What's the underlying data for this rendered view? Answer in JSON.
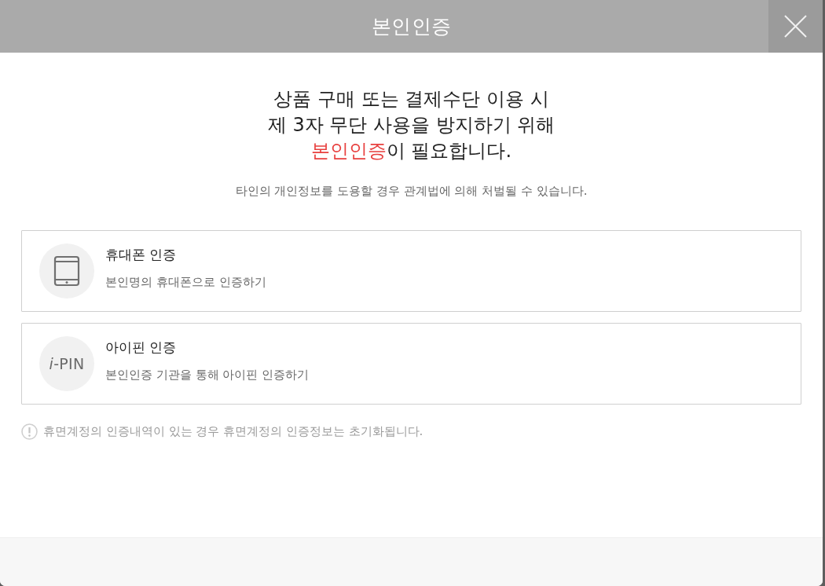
{
  "window": {
    "title": "본인인증"
  },
  "message": {
    "lines": [
      [
        {
          "text": "상품 구매 또는 결제수단 이용 시",
          "highlight": false
        }
      ],
      [
        {
          "text": "제 3자 무단 사용을 방지하기 위해",
          "highlight": false
        }
      ],
      [
        {
          "text": "본인인증",
          "highlight": true
        },
        {
          "text": "이 필요합니다.",
          "highlight": false
        }
      ]
    ],
    "warning": "타인의 개인정보를 도용할 경우 관계법에 의해 처벌될 수 있습니다."
  },
  "options": [
    {
      "kind": "phone",
      "title": "휴대폰 인증",
      "description": "본인명의 휴대폰으로 인증하기"
    },
    {
      "kind": "ipin",
      "logo": "*i*-PIN",
      "title": "아이핀 인증",
      "description": "본인인증 기관을 통해 아이핀 인증하기"
    }
  ],
  "notice": "휴면계정의 인증내역이 있는 경우 휴면계정의 인증정보는 초기화됩니다."
}
